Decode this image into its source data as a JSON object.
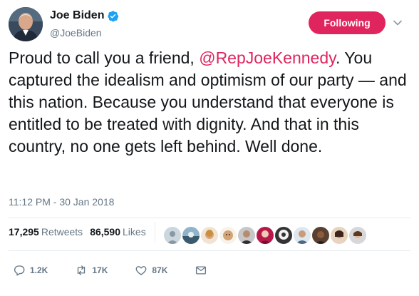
{
  "author": {
    "display_name": "Joe Biden",
    "handle": "@JoeBiden",
    "verified": true
  },
  "follow_button_label": "Following",
  "text": {
    "before_mention": "Proud to call you a friend, ",
    "mention": "@RepJoeKennedy",
    "after_mention": ". You captured the idealism and optimism of our party — and this nation. Because you understand that everyone is entitled to be treated with dignity. And that in this country, no one gets left behind. Well done."
  },
  "timestamp": "11:12 PM - 30 Jan 2018",
  "stats": {
    "retweets_count": "17,295",
    "retweets_label": "Retweets",
    "likes_count": "86,590",
    "likes_label": "Likes"
  },
  "actions": {
    "reply_count": "1.2K",
    "retweet_count": "17K",
    "like_count": "87K"
  },
  "colors": {
    "accent": "#e0245e",
    "muted": "#657786",
    "verified": "#1da1f2"
  },
  "icons": [
    "verified-badge-icon",
    "chevron-down-icon",
    "reply-icon",
    "retweet-icon",
    "like-icon",
    "direct-message-icon"
  ]
}
